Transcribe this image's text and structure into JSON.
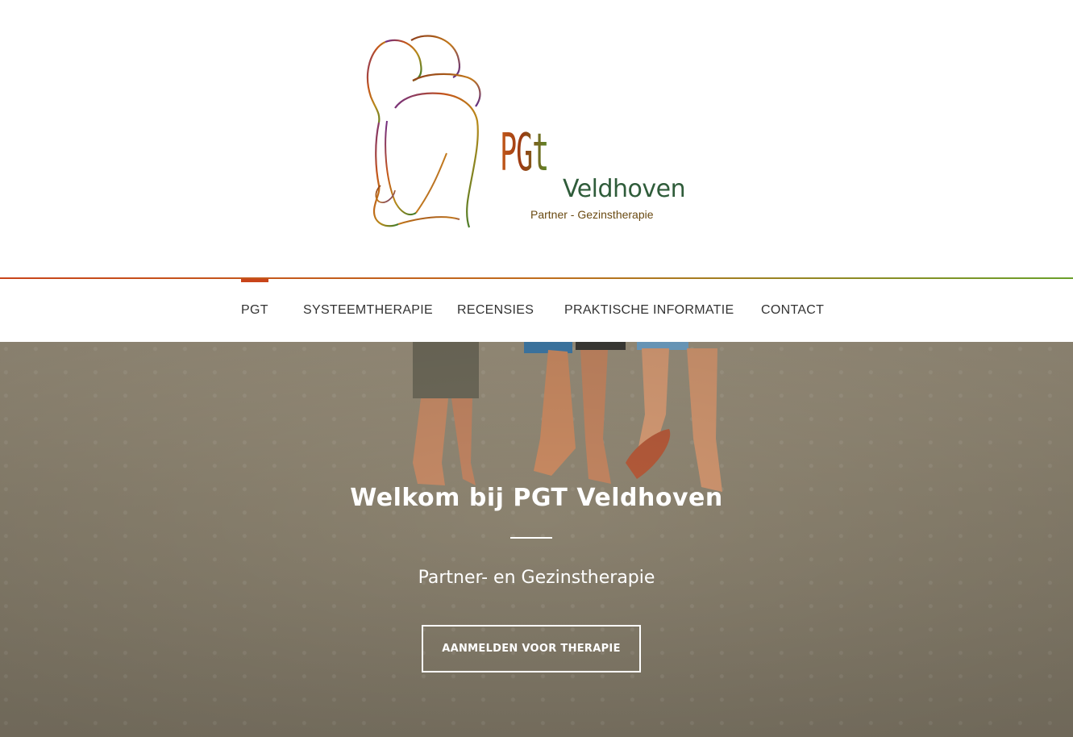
{
  "logo": {
    "mark": "PGt",
    "name": "Veldhoven",
    "tagline": "Partner - Gezinstherapie"
  },
  "nav": {
    "items": [
      {
        "label": "PGT",
        "active": true
      },
      {
        "label": "SYSTEEMTHERAPIE",
        "active": false
      },
      {
        "label": "RECENSIES",
        "active": false
      },
      {
        "label": "PRAKTISCHE INFORMATIE",
        "active": false
      },
      {
        "label": "CONTACT",
        "active": false
      }
    ]
  },
  "hero": {
    "title": "Welkom bij PGT Veldhoven",
    "subtitle": "Partner- en Gezinstherapie",
    "cta": "AANMELDEN VOOR THERAPIE"
  },
  "colors": {
    "accent": "#c8441a",
    "green": "#6aa02a",
    "nav_text": "#333333"
  }
}
